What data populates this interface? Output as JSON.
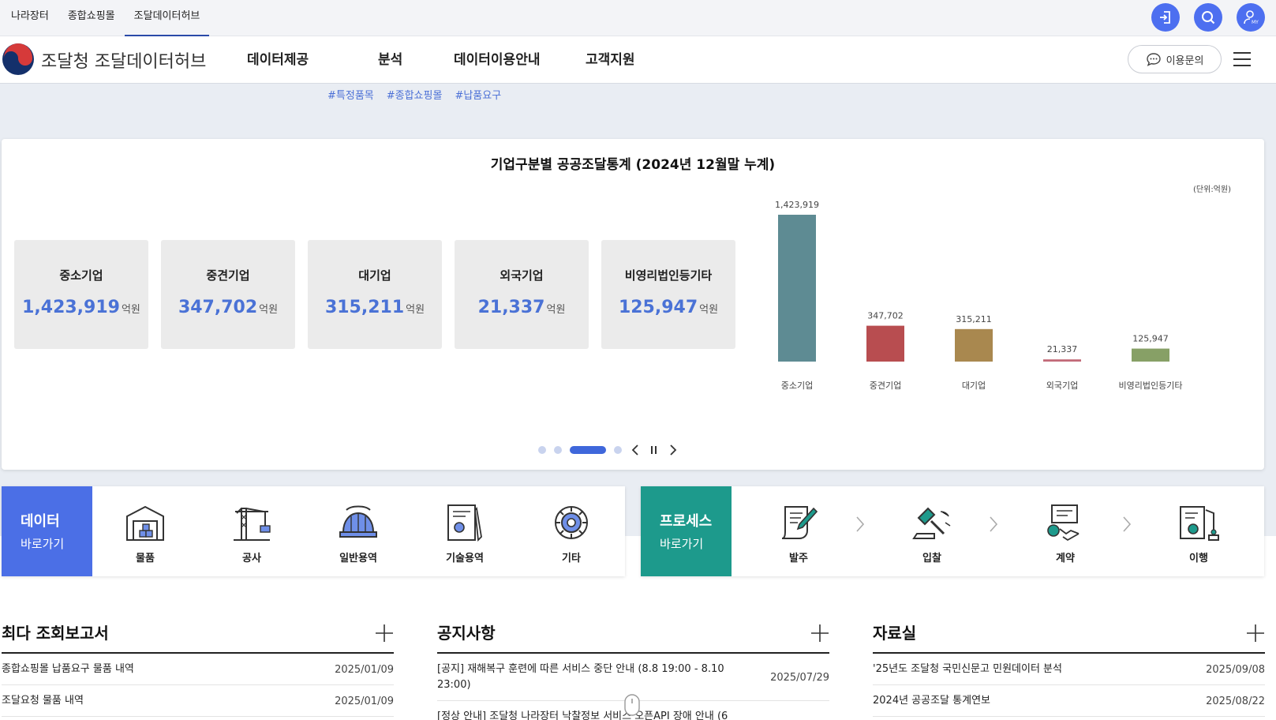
{
  "top_tabs": [
    "나라장터",
    "종합쇼핑몰",
    "조달데이터허브"
  ],
  "site_title": "조달청 조달데이터허브",
  "nav": [
    "데이터제공",
    "분석",
    "데이터이용안내",
    "고객지원"
  ],
  "inquiry_label": "이용문의",
  "hashtags": [
    "#특정품목",
    "#종합쇼핑몰",
    "#납품요구"
  ],
  "stats": {
    "title": "기업구분별 공공조달통계 (2024년 12월말 누계)",
    "unit_note": "(단위:억원)",
    "unit_label": "억원",
    "boxes": [
      {
        "label": "중소기업",
        "value": "1,423,919"
      },
      {
        "label": "중견기업",
        "value": "347,702"
      },
      {
        "label": "대기업",
        "value": "315,211"
      },
      {
        "label": "외국기업",
        "value": "21,337"
      },
      {
        "label": "비영리법인등기타",
        "value": "125,947"
      }
    ]
  },
  "chart_data": {
    "type": "bar",
    "categories": [
      "중소기업",
      "중견기업",
      "대기업",
      "외국기업",
      "비영리법인등기타"
    ],
    "values": [
      1423919,
      347702,
      315211,
      21337,
      125947
    ],
    "value_labels": [
      "1,423,919",
      "347,702",
      "315,211",
      "21,337",
      "125,947"
    ],
    "colors": [
      "#5e8b93",
      "#b84d50",
      "#a9884f",
      "#c26a78",
      "#87a066"
    ],
    "title": "",
    "xlabel": "",
    "ylabel": "",
    "ylim": [
      0,
      1423919
    ],
    "grid": false
  },
  "quick_data": {
    "title1": "데이터",
    "title2": "바로가기",
    "color": "#4b6fe6",
    "items": [
      "물품",
      "공사",
      "일반용역",
      "기술용역",
      "기타"
    ]
  },
  "quick_process": {
    "title1": "프로세스",
    "title2": "바로가기",
    "color": "#1d9a8c",
    "items": [
      "발주",
      "입찰",
      "계약",
      "이행"
    ]
  },
  "boards": [
    {
      "title": "최다 조회보고서",
      "rows": [
        {
          "text": "종합쇼핑몰 납품요구 물품 내역",
          "date": "2025/01/09"
        },
        {
          "text": "조달요청 물품 내역",
          "date": "2025/01/09"
        }
      ]
    },
    {
      "title": "공지사항",
      "rows": [
        {
          "text": "[공지] 재해복구 훈련에 따른 서비스 중단 안내 (8.8 19:00 - 8.10 23:00)",
          "date": "2025/07/29"
        },
        {
          "text": "[정상 안내] 조달청 나라장터 낙찰정보 서비스 오픈API 장애 안내 (6",
          "date": ""
        }
      ]
    },
    {
      "title": "자료실",
      "rows": [
        {
          "text": "'25년도 조달청 국민신문고 민원데이터 분석",
          "date": "2025/09/08"
        },
        {
          "text": "2024년 공공조달 통계연보",
          "date": "2025/08/22"
        }
      ]
    }
  ]
}
